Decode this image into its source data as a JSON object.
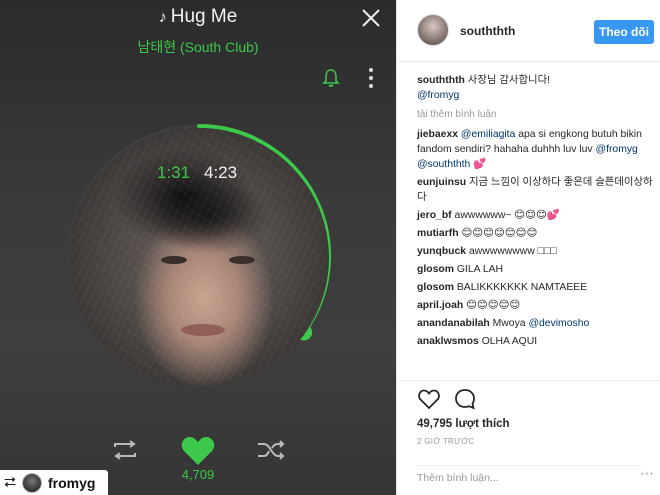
{
  "player": {
    "song_title": "Hug Me",
    "artist": "남태현 (South Club)",
    "time_current": "1:31",
    "time_total": "4:23",
    "progress_fraction": 0.35,
    "like_count": "4,709",
    "accent_color": "#3cc84a",
    "icons": [
      "music-note-icon",
      "close-icon",
      "bell-icon",
      "kebab-menu-icon",
      "repeat-icon",
      "heart-icon",
      "shuffle-icon"
    ]
  },
  "repost": {
    "username": "fromyg"
  },
  "post": {
    "header": {
      "username": "souththth",
      "follow_label": "Theo dõi"
    },
    "caption": {
      "username": "souththth",
      "text": "사장님 감사합니다!",
      "mention": "@fromyg"
    },
    "load_more": "tải thêm bình luận",
    "comments": [
      {
        "user": "jiebaexx",
        "mention": "@emiliagita",
        "text": "apa si engkong butuh bikin fandom sendiri? hahaha duhhh luv luv",
        "mention2": "@fromyg @souththth",
        "tail": "💕"
      },
      {
        "user": "eunjuinsu",
        "text": "지금 느낌이 이상하다 좋은데 슬픈데이상하다"
      },
      {
        "user": "jero_bf",
        "text": "awwwwww~ 😊😊😊💕"
      },
      {
        "user": "mutiarfh",
        "text": "😊😊😊😊😊😊😊"
      },
      {
        "user": "yunqbuck",
        "text": "awwwwwwww □□□"
      },
      {
        "user": "glosom",
        "text": "GILA LAH"
      },
      {
        "user": "glosom",
        "text": "BALIKKKKKKK NAMTAEEE"
      },
      {
        "user": "april.joah",
        "text": "😊😊😊😊😊"
      },
      {
        "user": "anandanabilah",
        "text": "Mwoya",
        "mention": "@devimosho"
      },
      {
        "user": "anaklwsmos",
        "text": "OLHA AQUI"
      }
    ],
    "likes_text": "49,795 lượt thích",
    "time_ago": "2 GIỜ TRƯỚC",
    "add_comment_placeholder": "Thêm bình luận...",
    "link_color": "#003569",
    "button_color": "#3897f0"
  }
}
